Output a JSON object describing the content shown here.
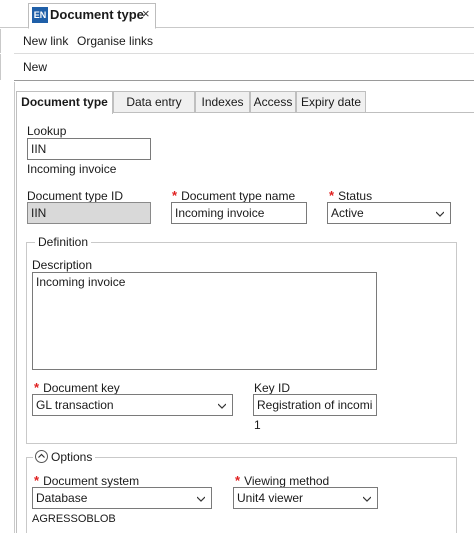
{
  "doc_tab": {
    "badge": "EN",
    "title": "Document type",
    "close": "×"
  },
  "toolbar": {
    "new_link": "New link",
    "organise_links": "Organise links",
    "new": "New"
  },
  "tabs": [
    "Document type",
    "Data entry",
    "Indexes",
    "Access",
    "Expiry date"
  ],
  "lookup": {
    "label": "Lookup",
    "value": "IIN",
    "hint": "Incoming invoice"
  },
  "doc_type_id": {
    "label": "Document type ID",
    "value": "IIN"
  },
  "doc_type_name": {
    "required": "*",
    "label": "Document type name",
    "value": "Incoming invoice"
  },
  "status": {
    "required": "*",
    "label": "Status",
    "value": "Active"
  },
  "definition": {
    "legend": "Definition",
    "description_label": "Description",
    "description_value": "Incoming invoice",
    "document_key": {
      "required": "*",
      "label": "Document key",
      "value": "GL transaction"
    },
    "key_id": {
      "label": "Key ID",
      "value": "Registration of incomi",
      "sub": "1"
    }
  },
  "options": {
    "legend": "Options",
    "document_system": {
      "required": "*",
      "label": "Document system",
      "value": "Database",
      "sub": "AGRESSOBLOB"
    },
    "viewing_method": {
      "required": "*",
      "label": "Viewing method",
      "value": "Unit4 viewer"
    }
  },
  "colors": {
    "badge": "#1f5fa8",
    "required": "#e02020",
    "readonly_bg": "#d9d9d9"
  },
  "icons": [
    "close-icon",
    "chevron-down-icon",
    "collapse-up-icon"
  ]
}
